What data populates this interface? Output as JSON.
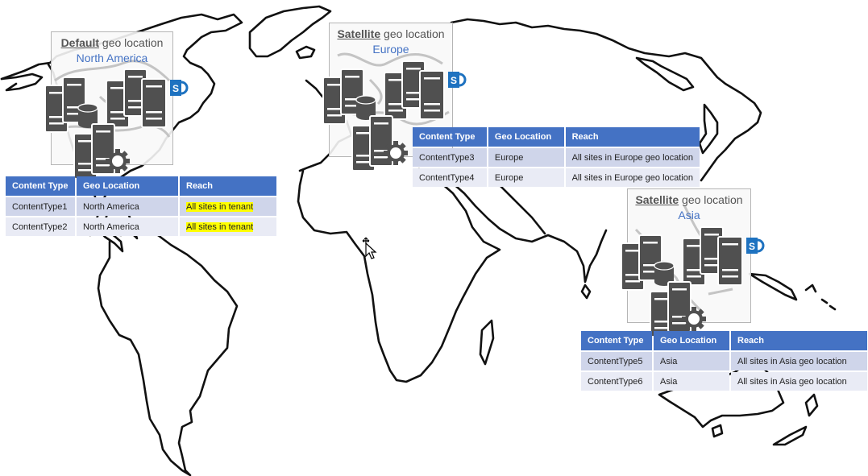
{
  "diagram": {
    "background": "world-map-outline",
    "colors": {
      "header_blue": "#4472c4",
      "row_odd": "#cfd5ea",
      "row_even": "#e9ebf5",
      "region_text": "#4472c4",
      "highlight": "#ffff00",
      "server_gray": "#505050",
      "sharepoint_blue": "#1e72c0"
    },
    "locations": [
      {
        "id": "north-america",
        "kind_label": "Default",
        "suffix": "geo location",
        "region": "North America",
        "icons": [
          "server-database-icon",
          "server-cluster-icon",
          "sharepoint-icon",
          "server-settings-icon"
        ],
        "table": {
          "headers": [
            "Content Type",
            "Geo Location",
            "Reach"
          ],
          "rows": [
            [
              "ContentType1",
              "North America",
              "All sites in tenant"
            ],
            [
              "ContentType2",
              "North America",
              "All sites in tenant"
            ]
          ],
          "highlight_reach": true
        }
      },
      {
        "id": "europe",
        "kind_label": "Satellite",
        "suffix": "geo location",
        "region": "Europe",
        "icons": [
          "server-database-icon",
          "server-cluster-icon",
          "sharepoint-icon",
          "server-settings-icon"
        ],
        "table": {
          "headers": [
            "Content Type",
            "Geo Location",
            "Reach"
          ],
          "rows": [
            [
              "ContentType3",
              "Europe",
              "All sites in Europe geo location"
            ],
            [
              "ContentType4",
              "Europe",
              "All sites in Europe geo location"
            ]
          ],
          "highlight_reach": false
        }
      },
      {
        "id": "asia",
        "kind_label": "Satellite",
        "suffix": "geo location",
        "region": "Asia",
        "icons": [
          "server-database-icon",
          "server-cluster-icon",
          "sharepoint-icon",
          "server-settings-icon"
        ],
        "table": {
          "headers": [
            "Content Type",
            "Geo Location",
            "Reach"
          ],
          "rows": [
            [
              "ContentType5",
              "Asia",
              "All sites in Asia geo location"
            ],
            [
              "ContentType6",
              "Asia",
              "All sites in Asia geo location"
            ]
          ],
          "highlight_reach": false
        }
      }
    ],
    "cursor": "move-cursor-icon",
    "sharepoint_letter": "S"
  }
}
